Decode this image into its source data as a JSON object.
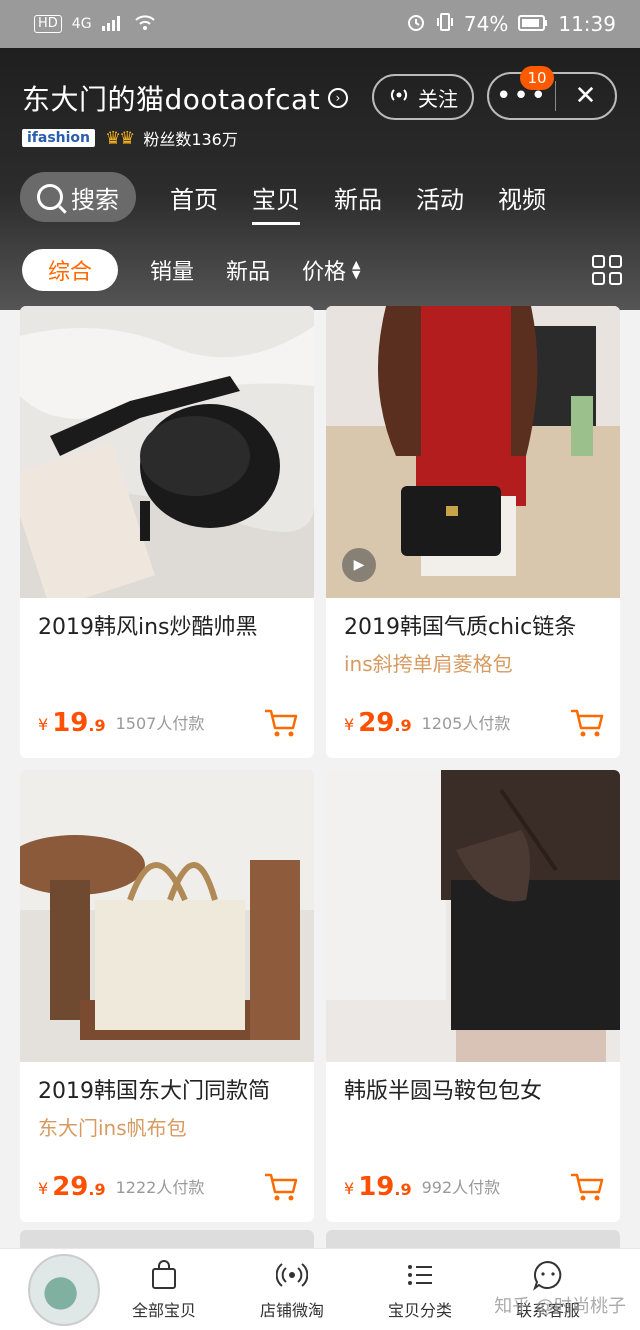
{
  "status_bar": {
    "carrier_badge": "HD",
    "network": "4G",
    "battery": "74%",
    "time": "11:39"
  },
  "header": {
    "shop_name": "东大门的猫dootaofcat",
    "badge": "ifashion",
    "fans": "粉丝数136万",
    "follow_label": "关注",
    "notification_count": "10"
  },
  "nav": {
    "search_label": "搜索",
    "tabs": [
      {
        "label": "首页"
      },
      {
        "label": "宝贝"
      },
      {
        "label": "新品"
      },
      {
        "label": "活动"
      },
      {
        "label": "视频"
      }
    ],
    "active_tab": "宝贝"
  },
  "sort": {
    "items": [
      "综合",
      "销量",
      "新品",
      "价格"
    ],
    "active": "综合"
  },
  "products": [
    {
      "title": "2019韩风ins炒酷帅黑",
      "subtitle": "",
      "price_int": "19",
      "price_dec": ".9",
      "sold": "1507人付款",
      "yen": "¥"
    },
    {
      "title": "2019韩国气质chic链条",
      "subtitle": "ins斜挎单肩菱格包",
      "price_int": "29",
      "price_dec": ".9",
      "sold": "1205人付款",
      "yen": "¥"
    },
    {
      "title": "2019韩国东大门同款简",
      "subtitle": "东大门ins帆布包",
      "price_int": "29",
      "price_dec": ".9",
      "sold": "1222人付款",
      "yen": "¥"
    },
    {
      "title": "韩版半圆马鞍包包女",
      "subtitle": "",
      "price_int": "19",
      "price_dec": ".9",
      "sold": "992人付款",
      "yen": "¥"
    }
  ],
  "bottom_bar": {
    "items": [
      {
        "label": "全部宝贝",
        "icon": "bag-icon"
      },
      {
        "label": "店铺微淘",
        "icon": "broadcast-icon"
      },
      {
        "label": "宝贝分类",
        "icon": "list-icon"
      },
      {
        "label": "联系客服",
        "icon": "chat-face-icon"
      }
    ],
    "watermark": "知乎 @时尚桃子"
  },
  "colors": {
    "accent": "#ff5000",
    "subtitle": "#d79a60",
    "header_bg": "#1f1f1f"
  }
}
